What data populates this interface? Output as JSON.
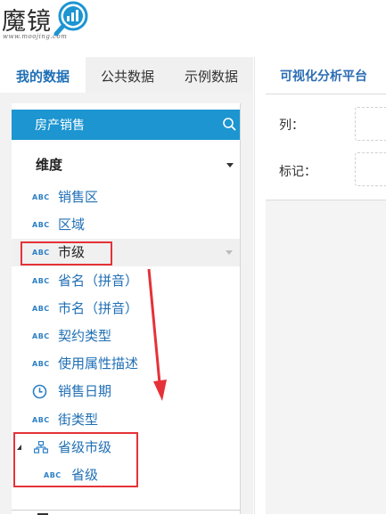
{
  "app": {
    "logo_text": "魔镜",
    "logo_subtext": "www.moojing.com"
  },
  "tabs": [
    {
      "label": "我的数据",
      "active": true
    },
    {
      "label": "公共数据",
      "active": false
    },
    {
      "label": "示例数据",
      "active": false
    }
  ],
  "dataset": {
    "name": "房产销售"
  },
  "dimensions": {
    "title": "维度",
    "fields": [
      {
        "type": "ABC",
        "label": "销售区",
        "icon": "abc-icon"
      },
      {
        "type": "ABC",
        "label": "区域",
        "icon": "abc-icon"
      },
      {
        "type": "ABC",
        "label": "市级",
        "icon": "abc-icon",
        "highlighted": true
      },
      {
        "type": "ABC",
        "label": "省名（拼音）",
        "icon": "abc-icon"
      },
      {
        "type": "ABC",
        "label": "市名（拼音）",
        "icon": "abc-icon"
      },
      {
        "type": "ABC",
        "label": "契约类型",
        "icon": "abc-icon"
      },
      {
        "type": "ABC",
        "label": "使用属性描述",
        "icon": "abc-icon"
      },
      {
        "type": "",
        "label": "销售日期",
        "icon": "clock-icon"
      },
      {
        "type": "ABC",
        "label": "街类型",
        "icon": "abc-icon"
      },
      {
        "type": "",
        "label": "省级市级",
        "icon": "hierarchy-icon"
      },
      {
        "type": "ABC",
        "label": "省级",
        "icon": "abc-icon"
      }
    ]
  },
  "right_panel": {
    "title": "可视化分析平台",
    "column_label": "列：",
    "marker_label": "标记："
  },
  "colors": {
    "accent": "#1c95d1",
    "link": "#1f6fb5",
    "annotation": "#e53238"
  }
}
